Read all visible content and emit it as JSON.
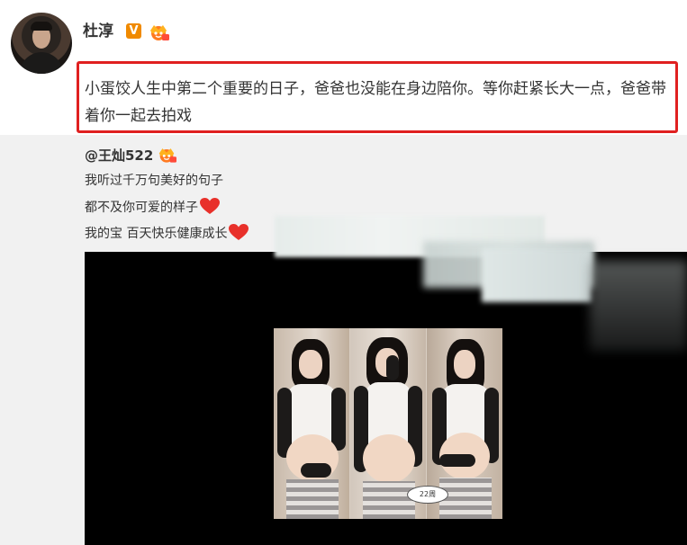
{
  "post": {
    "username": "杜淳",
    "verified_badge": "V",
    "text": "小蛋饺人生中第二个重要的日子，爸爸也没能在身边陪你。等你赶紧长大一点，爸爸带着你一起去拍戏"
  },
  "repost": {
    "author": "@王灿522",
    "lines": [
      "我听过千万句美好的句子",
      "都不及你可爱的样子",
      "我的宝 百天快乐健康成长"
    ],
    "photo_sticker": "22周"
  },
  "colors": {
    "highlight_border": "#e02020",
    "verified_orange": "#f08a00",
    "heart_red": "#e8302a",
    "repost_bg": "#f1f1f1"
  },
  "icons": [
    "verified-v-icon",
    "vip-crown-icon",
    "heart-icon"
  ]
}
